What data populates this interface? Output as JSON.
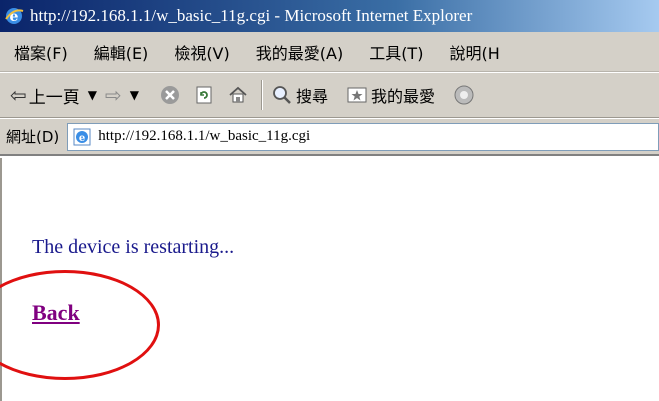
{
  "window": {
    "title": "http://192.168.1.1/w_basic_11g.cgi - Microsoft Internet Explorer"
  },
  "menu": {
    "items": [
      "檔案(F)",
      "編輯(E)",
      "檢視(V)",
      "我的最愛(A)",
      "工具(T)",
      "說明(H"
    ]
  },
  "toolbar": {
    "back_label": "上一頁",
    "search_label": "搜尋",
    "favorites_label": "我的最愛"
  },
  "address": {
    "label": "網址(D)",
    "url": "http://192.168.1.1/w_basic_11g.cgi"
  },
  "content": {
    "message": "The device is restarting...",
    "back_link": "Back"
  },
  "colors": {
    "annotation_circle": "#e01010",
    "link_visited": "#800080",
    "message_text": "#1a1a8c"
  }
}
